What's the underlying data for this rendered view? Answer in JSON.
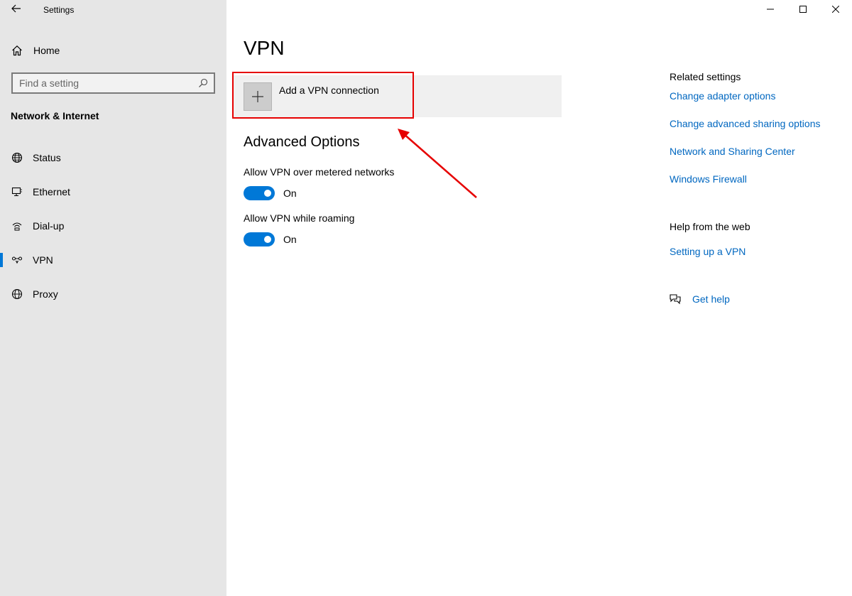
{
  "window": {
    "title": "Settings"
  },
  "sidebar": {
    "home_label": "Home",
    "search_placeholder": "Find a setting",
    "section_title": "Network & Internet",
    "items": [
      {
        "label": "Status",
        "icon": "globe-status-icon"
      },
      {
        "label": "Ethernet",
        "icon": "ethernet-icon"
      },
      {
        "label": "Dial-up",
        "icon": "dialup-icon"
      },
      {
        "label": "VPN",
        "icon": "vpn-icon",
        "active": true
      },
      {
        "label": "Proxy",
        "icon": "globe-icon"
      }
    ]
  },
  "main": {
    "title": "VPN",
    "add_vpn_label": "Add a VPN connection",
    "advanced_title": "Advanced Options",
    "options": [
      {
        "label": "Allow VPN over metered networks",
        "state": "On"
      },
      {
        "label": "Allow VPN while roaming",
        "state": "On"
      }
    ]
  },
  "right": {
    "related_title": "Related settings",
    "related_links": [
      "Change adapter options",
      "Change advanced sharing options",
      "Network and Sharing Center",
      "Windows Firewall"
    ],
    "help_title": "Help from the web",
    "help_links": [
      "Setting up a VPN"
    ],
    "get_help_label": "Get help"
  },
  "colors": {
    "accent": "#0078d7",
    "link": "#0067c0",
    "annotation": "#e60000",
    "sidebar_bg": "#e6e6e6"
  }
}
